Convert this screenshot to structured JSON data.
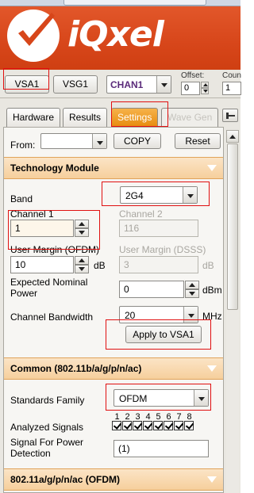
{
  "app": {
    "logo_text": "iQxel"
  },
  "toolbar": {
    "vsa_label": "VSA1",
    "vsg_label": "VSG1",
    "channel_value": "CHAN1",
    "offset_label": "Offset:",
    "offset_value": "0",
    "count_label": "Coun",
    "count_value": "1"
  },
  "tabs": [
    {
      "label": "Hardware"
    },
    {
      "label": "Results"
    },
    {
      "label": "Settings"
    },
    {
      "label": "Wave Gen"
    }
  ],
  "settings": {
    "from_label": "From:",
    "from_value": "",
    "copy_label": "COPY",
    "reset_label": "Reset"
  },
  "technology_module": {
    "header": "Technology Module",
    "band_label": "Band",
    "band_value": "2G4",
    "channel1_label": "Channel 1",
    "channel1_value": "1",
    "channel2_label": "Channel 2",
    "channel2_value": "116",
    "user_margin_ofdm_label": "User Margin (OFDM)",
    "user_margin_ofdm_value": "10",
    "user_margin_ofdm_unit": "dB",
    "user_margin_dsss_label": "User Margin (DSSS)",
    "user_margin_dsss_value": "3",
    "user_margin_dsss_unit": "dB",
    "expected_power_label_1": "Expected Nominal",
    "expected_power_label_2": "Power",
    "expected_power_value": "0",
    "expected_power_unit": "dBm",
    "bandwidth_label": "Channel Bandwidth",
    "bandwidth_value": "20",
    "bandwidth_unit": "MHz",
    "apply_label": "Apply to VSA1"
  },
  "common": {
    "header": "Common (802.11b/a/g/p/n/ac)",
    "standards_family_label": "Standards Family",
    "standards_family_value": "OFDM",
    "analyzed_signals_label": "Analyzed Signals",
    "analyzed_signals_numbers": [
      "1",
      "2",
      "3",
      "4",
      "5",
      "6",
      "7",
      "8"
    ],
    "signal_power_label_1": "Signal For Power",
    "signal_power_label_2": "Detection",
    "signal_power_value": "(1)"
  },
  "ofdm_section": {
    "header": "802.11a/g/p/n/ac (OFDM)"
  }
}
